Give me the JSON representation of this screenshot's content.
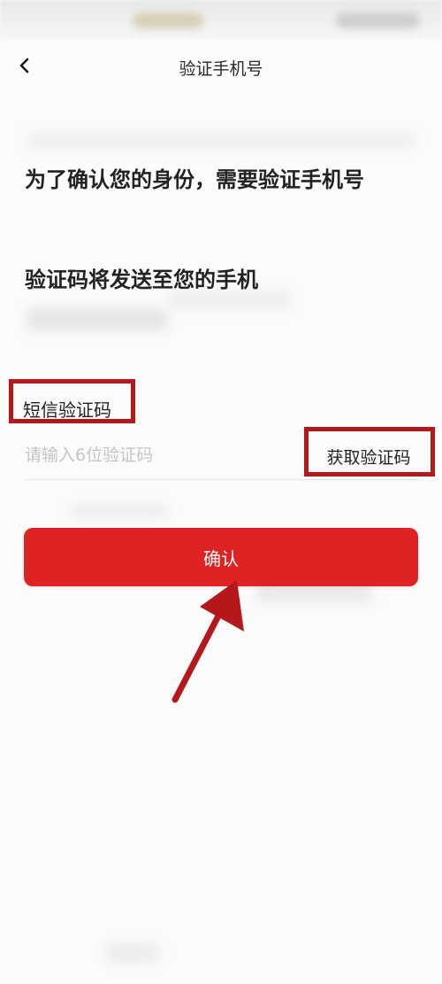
{
  "nav": {
    "title": "验证手机号"
  },
  "main": {
    "headline_identity": "为了确认您的身份，需要验证手机号",
    "headline_send": "验证码将发送至您的手机",
    "sms_label": "短信验证码",
    "code_placeholder": "请输入6位验证码",
    "code_value": "",
    "get_code_label": "获取验证码",
    "confirm_label": "确认"
  },
  "icons": {
    "back": "chevron-left-icon"
  },
  "colors": {
    "accent": "#de2325",
    "highlight": "#b4181b",
    "background": "#fbfbfb"
  }
}
